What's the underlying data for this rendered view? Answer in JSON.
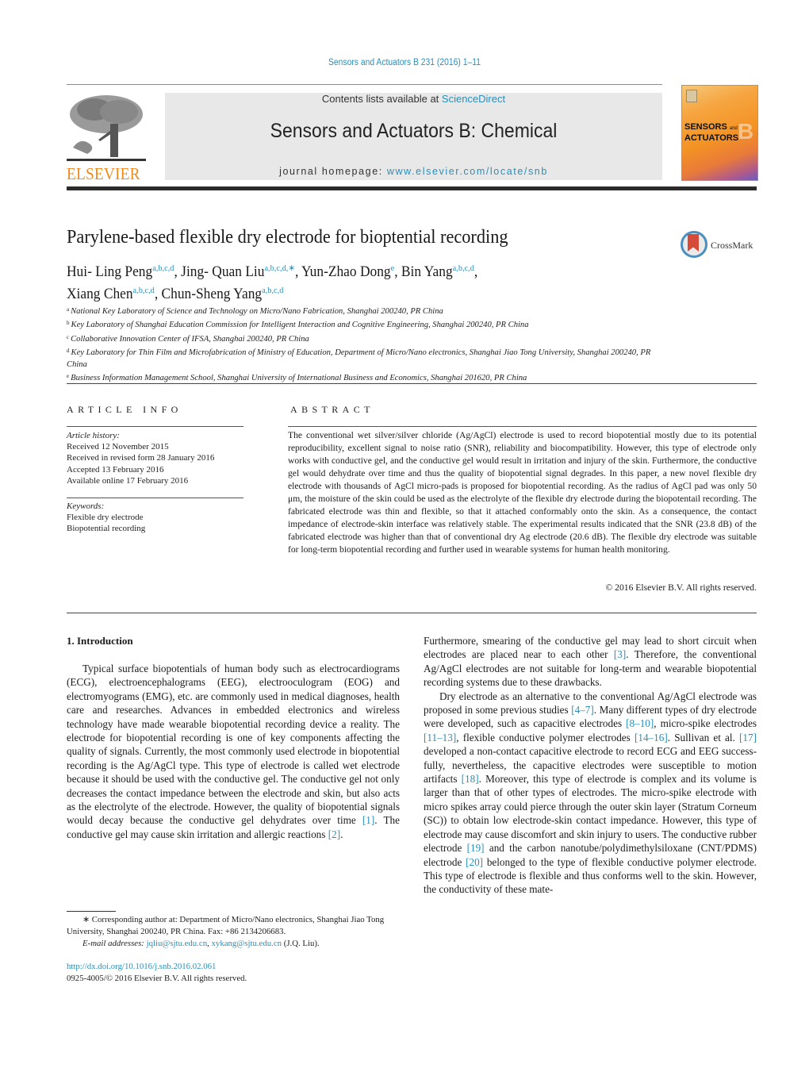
{
  "header": {
    "running_head": "Sensors and Actuators B 231 (2016) 1–11",
    "contents_prefix": "Contents lists available at ",
    "contents_link": "ScienceDirect",
    "journal_title": "Sensors and Actuators B: Chemical",
    "homepage_prefix": "journal homepage: ",
    "homepage_link": "www.elsevier.com/locate/snb",
    "publisher_logo_text": "ELSEVIER",
    "cover": {
      "line1": "SENSORS",
      "and": "and",
      "line2": "ACTUATORS",
      "letter": "B"
    }
  },
  "article": {
    "title": "Parylene-based flexible dry electrode for bioptential recording",
    "crossmark_label": "CrossMark",
    "authors": [
      {
        "name": "Hui- Ling Peng",
        "affil": "a,b,c,d",
        "sep": ", "
      },
      {
        "name": "Jing- Quan Liu",
        "affil": "a,b,c,d,∗",
        "sep": ", "
      },
      {
        "name": "Yun-Zhao Dong",
        "affil": "e",
        "sep": ", "
      },
      {
        "name": "Bin Yang",
        "affil": "a,b,c,d",
        "sep": ","
      },
      {
        "name": "Xiang Chen",
        "affil": "a,b,c,d",
        "sep": ", "
      },
      {
        "name": "Chun-Sheng Yang",
        "affil": "a,b,c,d",
        "sep": ""
      }
    ],
    "affiliations": [
      {
        "key": "a",
        "text": "National Key Laboratory of Science and Technology on Micro/Nano Fabrication, Shanghai 200240, PR China"
      },
      {
        "key": "b",
        "text": "Key Laboratory of Shanghai Education Commission for Intelligent Interaction and Cognitive Engineering, Shanghai 200240, PR China"
      },
      {
        "key": "c",
        "text": "Collaborative Innovation Center of IFSA, Shanghai 200240, PR China"
      },
      {
        "key": "d",
        "text": "Key Laboratory for Thin Film and Microfabrication of Ministry of Education, Department of Micro/Nano electronics, Shanghai Jiao Tong University, Shanghai 200240, PR China"
      },
      {
        "key": "e",
        "text": "Business Information Management School, Shanghai University of International Business and Economics, Shanghai 201620, PR China"
      }
    ]
  },
  "article_info": {
    "heading": "ARTICLE INFO",
    "history_label": "Article history:",
    "history": [
      "Received 12 November 2015",
      "Received in revised form 28 January 2016",
      "Accepted 13 February 2016",
      "Available online 17 February 2016"
    ],
    "keywords_label": "Keywords:",
    "keywords": [
      "Flexible dry electrode",
      "Biopotential recording"
    ]
  },
  "abstract": {
    "heading": "ABSTRACT",
    "text": "The conventional wet silver/silver chloride (Ag/AgCl) electrode is used to record biopotential mostly due to its potential reproducibility, excellent signal to noise ratio (SNR), reliability and biocompatibility. However, this type of electrode only works with conductive gel, and the conductive gel would result in irritation and injury of the skin. Furthermore, the conductive gel would dehydrate over time and thus the quality of biopotential signal degrades. In this paper, a new novel flexible dry electrode with thousands of AgCl micro-pads is proposed for biopotential recording. As the radius of AgCl pad was only 50 μm, the moisture of the skin could be used as the electrolyte of the flexible dry electrode during the biopotentail recording. The fabricated electrode was thin and flexible, so that it attached conformably onto the skin. As a consequence, the contact impedance of electrode-skin interface was relatively stable. The experimental results indicated that the SNR (23.8 dB) of the fabricated electrode was higher than that of conventional dry Ag electrode (20.6 dB). The flexible dry electrode was suitable for long-term biopotential recording and further used in wearable systems for human health monitoring.",
    "copyright": "© 2016 Elsevier B.V. All rights reserved."
  },
  "body": {
    "section_heading": "1.  Introduction",
    "left_paragraph": [
      {
        "t": "Typical surface biopotentials of human body such as electrocar­diograms (ECG), electroencephalograms (EEG), electrooculogram (EOG) and electromyograms (EMG), etc. are commonly used in medical diagnoses, health care and researches. Advances in embed­ded electronics and wireless technology have made wearable biopotential recording device a reality. The electrode for biopo­tential recording is one of key components affecting the quality of signals. Currently, the most commonly used electrode in biopo­tential recording is the Ag/AgCl type. This type of electrode is called wet electrode because it should be used with the conductive gel. The conductive gel not only decreases the contact impedance between the electrode and skin, but also acts as the electrolyte of the electrode. However, the quality of biopotential signals would decay because the conductive gel dehydrates over time "
      },
      {
        "ref": "[1]"
      },
      {
        "t": ". The conductive gel may cause skin irritation and allergic reactions "
      },
      {
        "ref": "[2]"
      },
      {
        "t": "."
      }
    ],
    "right_paragraph_1": [
      {
        "t": "Furthermore, smearing of the conductive gel may lead to short cir­cuit when electrodes are placed near to each other "
      },
      {
        "ref": "[3]"
      },
      {
        "t": ". Therefore, the conventional Ag/AgCl electrodes are not suitable for long-term and wearable biopotential recording systems due to these draw­backs."
      }
    ],
    "right_paragraph_2": [
      {
        "t": "Dry electrode as an alternative to the conventional Ag/AgCl electrode was proposed in some previous studies "
      },
      {
        "ref": "[4–7]"
      },
      {
        "t": ". Many dif­ferent types of dry electrode were developed, such as capacitive electrodes "
      },
      {
        "ref": "[8–10]"
      },
      {
        "t": ", micro-spike electrodes "
      },
      {
        "ref": "[11–13]"
      },
      {
        "t": ", flexible conduc­tive polymer electrodes "
      },
      {
        "ref": "[14–16]"
      },
      {
        "t": ". Sullivan et al. "
      },
      {
        "ref": "[17]"
      },
      {
        "t": " developed a non-contact capacitive electrode to record ECG and EEG success­fully, nevertheless, the capacitive electrodes were susceptible to motion artifacts "
      },
      {
        "ref": "[18]"
      },
      {
        "t": ". Moreover, this type of electrode is complex and its volume is larger than that of other types of electrodes. The micro-spike electrode with micro spikes array could pierce through the outer skin layer (Stratum Corneum (SC)) to obtain low electrode-skin contact impedance. However, this type of electrode may cause discomfort and skin injury to users. The conductive rub­ber electrode "
      },
      {
        "ref": "[19]"
      },
      {
        "t": " and the carbon nanotube/polydimethylsiloxane (CNT/PDMS) electrode "
      },
      {
        "ref": "[20]"
      },
      {
        "t": " belonged to the type of flexible conduc­tive polymer electrode. This type of electrode is flexible and thus conforms well to the skin. However, the conductivity of these mate-"
      }
    ]
  },
  "footnote": {
    "corresponding": "∗  Corresponding author at: Department of Micro/Nano electronics, Shanghai Jiao Tong University, Shanghai 200240, PR China. Fax: +86 2134206683.",
    "email_label": "E-mail addresses:",
    "emails": [
      "jqliu@sjtu.edu.cn",
      "xykang@sjtu.edu.cn"
    ],
    "email_suffix": " (J.Q. Liu).",
    "doi": "http://dx.doi.org/10.1016/j.snb.2016.02.061",
    "issn": "0925-4005/© 2016 Elsevier B.V. All rights reserved."
  },
  "colors": {
    "link": "#2a8fb8",
    "publisher_orange": "#f08a1d",
    "banner_gray": "#e8e8e8"
  }
}
